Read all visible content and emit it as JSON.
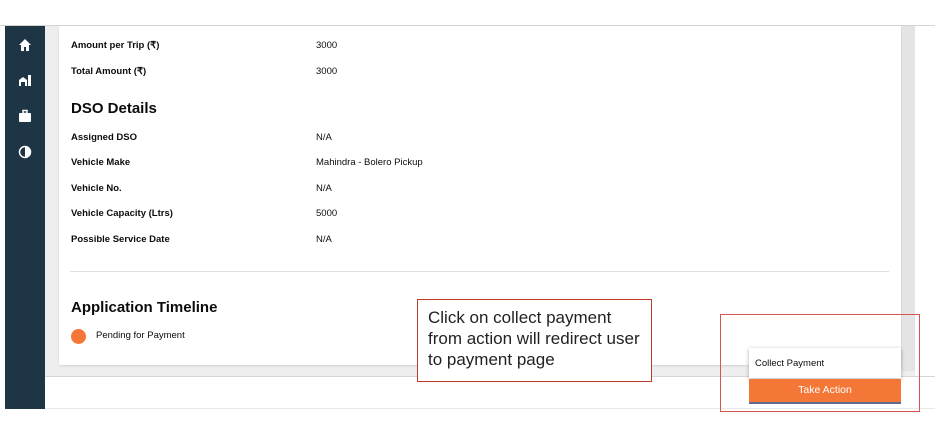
{
  "payment_rows": [
    {
      "label": "Amount per Trip (₹)",
      "value": "3000"
    },
    {
      "label": "Total Amount (₹)",
      "value": "3000"
    }
  ],
  "dso_section": {
    "title": "DSO Details",
    "rows": [
      {
        "label": "Assigned DSO",
        "value": "N/A"
      },
      {
        "label": "Vehicle Make",
        "value": "Mahindra - Bolero Pickup"
      },
      {
        "label": "Vehicle No.",
        "value": "N/A"
      },
      {
        "label": "Vehicle Capacity (Ltrs)",
        "value": "5000"
      },
      {
        "label": "Possible Service Date",
        "value": "N/A"
      }
    ]
  },
  "timeline": {
    "title": "Application Timeline",
    "items": [
      {
        "status": "Pending for Payment"
      }
    ]
  },
  "annotation": {
    "text": "Click on collect payment from action will redirect user to payment page"
  },
  "actions": {
    "menu_item": "Collect Payment",
    "button_label": "Take Action"
  },
  "sidebar": {
    "icons": [
      "home-icon",
      "city-icon",
      "briefcase-icon",
      "half-circle-icon"
    ]
  },
  "colors": {
    "accent": "#f47738",
    "sidebar": "#1e3545",
    "annotation_border": "#c0392b"
  }
}
